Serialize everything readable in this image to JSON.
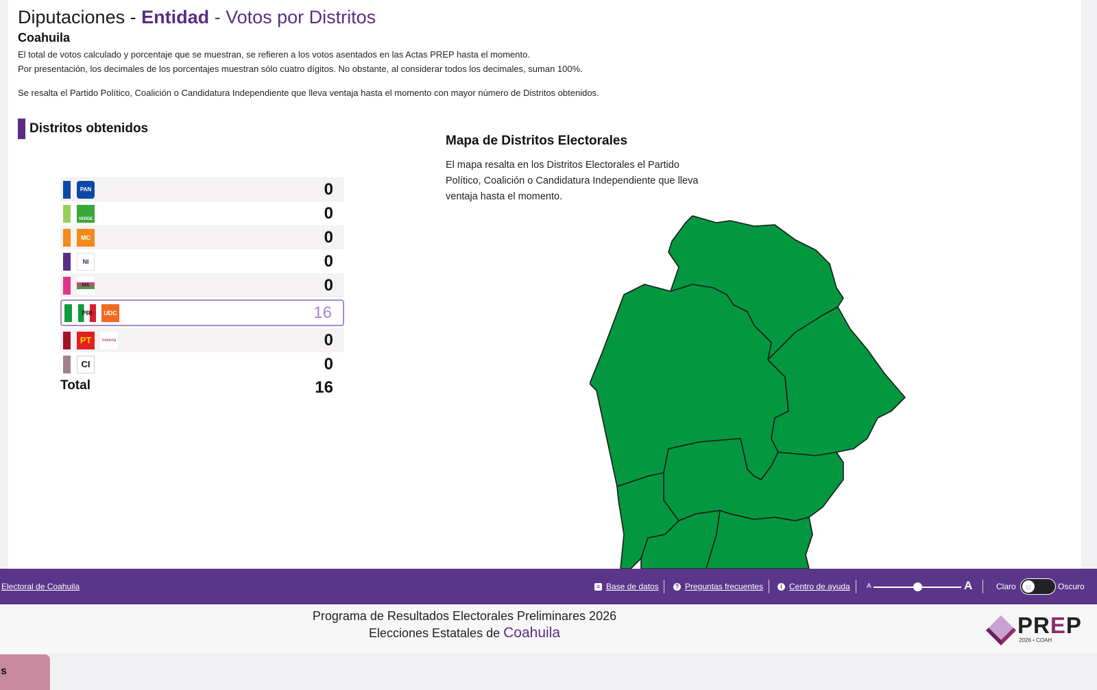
{
  "header": {
    "title_prefix": "Diputaciones - ",
    "title_entity": "Entidad",
    "title_suffix": " - Votos por Distritos",
    "subtitle": "Coahuila",
    "note1": "El total de votos calculado y porcentaje que se muestran, se refieren a los votos asentados en las Actas PREP hasta el momento.",
    "note2": "Por presentación, los decimales de los porcentajes muestran sólo cuatro dígitos. No obstante, al considerar todos los decimales, suman 100%.",
    "note3": "Se resalta el Partido Político, Coalición o Candidatura Independiente que lleva ventaja hasta el momento con mayor número de Distritos obtenidos."
  },
  "districts": {
    "section_title": "Distritos obtenidos",
    "rows": [
      {
        "party": "PAN",
        "color": "#0a4aa6",
        "logo_text": "PAN",
        "value": "0"
      },
      {
        "party": "VERDE",
        "color": "#9bcf5d",
        "logo_text": "VERDE",
        "value": "0"
      },
      {
        "party": "MOVIMIENTO CIUDADANO",
        "color": "#f28a1e",
        "logo_text": "MC",
        "value": "0"
      },
      {
        "party": "NUEVAS IDEAS",
        "color": "#5a2d82",
        "logo_text": "NI",
        "value": "0"
      },
      {
        "party": "MEXICO AVANZA ADELANTE",
        "color": "#e0338a",
        "logo_text": "MA",
        "value": "0"
      },
      {
        "party": "PRI-UDC",
        "color": "#0f9a3e",
        "logo_text": "PRI",
        "logo2_text": "UDC",
        "value": "16",
        "winner": true
      },
      {
        "party": "PT-MORENA",
        "color": "#a3142b",
        "logo_text": "PT",
        "logo2_text": "morena",
        "value": "0"
      },
      {
        "party": "CI",
        "color": "#a0838f",
        "logo_text": "CI",
        "value": "0"
      }
    ],
    "total_label": "Total",
    "total_value": "16"
  },
  "map": {
    "title": "Mapa de Distritos Electorales",
    "description": "El mapa resalta en los Distritos Electorales el Partido Político, Coalición o Candidatura Independiente que lleva ventaja hasta el momento.",
    "fill_color": "#039840"
  },
  "footer": {
    "left_link": "Electoral de Coahuila",
    "links": [
      "Base de datos",
      "Preguntas frecuentes",
      "Centro de ayuda"
    ],
    "font_small": "A",
    "font_big": "A",
    "theme_light": "Claro",
    "theme_dark": "Oscuro"
  },
  "bottom": {
    "line1": "Programa de Resultados Electorales Preliminares 2026",
    "line2_prefix": "Elecciones Estatales de ",
    "line2_state": "Coahuila",
    "logo_text_pr": "PR",
    "logo_text_e": "E",
    "logo_text_p": "P",
    "logo_year": "2026",
    "logo_state": "COAH"
  },
  "pink_button": "s"
}
